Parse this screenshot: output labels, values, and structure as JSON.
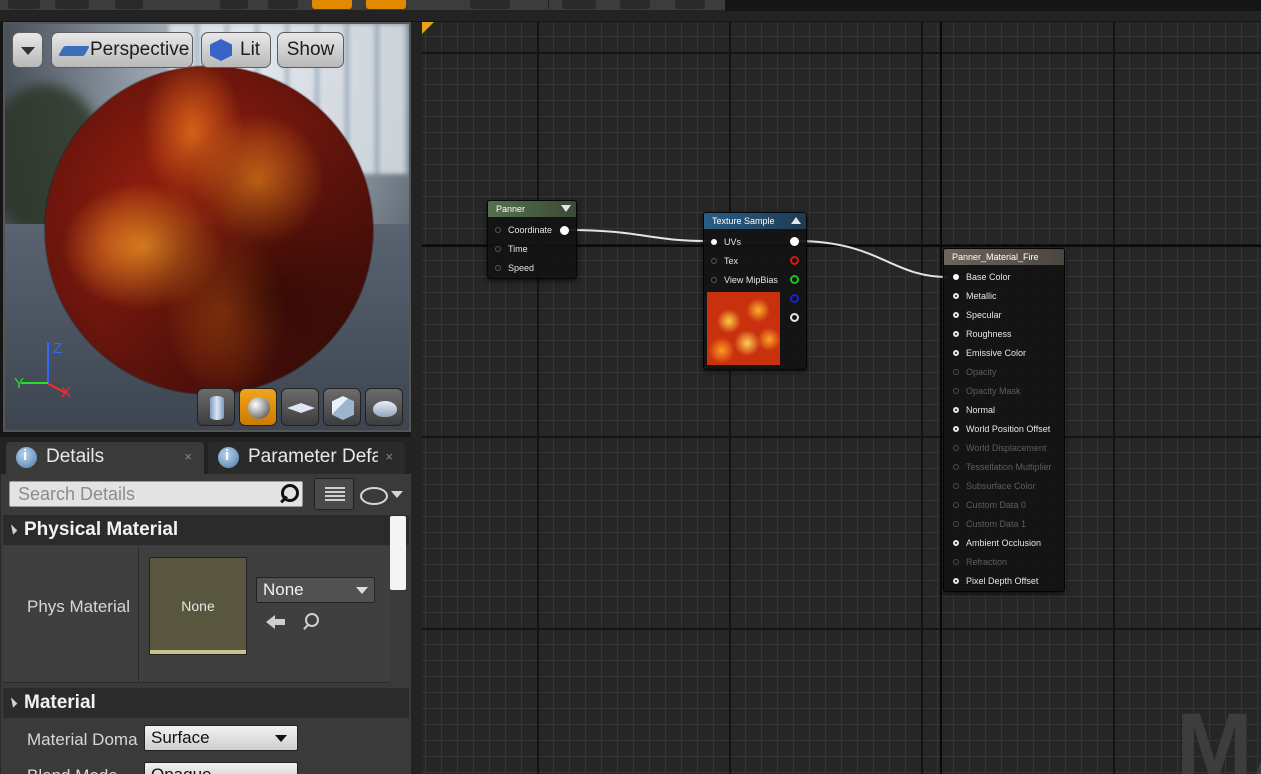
{
  "viewport": {
    "dropdown_label": "",
    "perspective_label": "Perspective",
    "lit_label": "Lit",
    "show_label": "Show",
    "axis": {
      "z": "Z",
      "x": "X",
      "y": "Y"
    },
    "preview_buttons": [
      "cylinder-icon",
      "sphere-icon",
      "plane-icon",
      "cube-icon",
      "teapot-icon"
    ]
  },
  "tabs": [
    {
      "label": "Details",
      "close": "×"
    },
    {
      "label": "Parameter Defa",
      "close": "×"
    }
  ],
  "search": {
    "placeholder": "Search Details"
  },
  "categories": {
    "physical_material": "Physical Material",
    "material": "Material"
  },
  "properties": {
    "phys_material_label": "Phys Material",
    "phys_material_thumb": "None",
    "phys_material_value": "None",
    "material_domain_label": "Material Doma",
    "material_domain_value": "Surface",
    "blend_mode_label": "Blend Mode",
    "blend_mode_value": "Opaque"
  },
  "nodes": {
    "panner": {
      "title": "Panner",
      "inputs": [
        "Coordinate",
        "Time",
        "Speed"
      ]
    },
    "texture_sample": {
      "title": "Texture Sample",
      "inputs": [
        "UVs",
        "Tex",
        "View MipBias"
      ]
    },
    "output": {
      "title": "Panner_Material_Fire",
      "inputs": [
        {
          "label": "Base Color",
          "enabled": true
        },
        {
          "label": "Metallic",
          "enabled": true
        },
        {
          "label": "Specular",
          "enabled": true
        },
        {
          "label": "Roughness",
          "enabled": true
        },
        {
          "label": "Emissive Color",
          "enabled": true
        },
        {
          "label": "Opacity",
          "enabled": false
        },
        {
          "label": "Opacity Mask",
          "enabled": false
        },
        {
          "label": "Normal",
          "enabled": true
        },
        {
          "label": "World Position Offset",
          "enabled": true
        },
        {
          "label": "World Displacement",
          "enabled": false
        },
        {
          "label": "Tessellation Multiplier",
          "enabled": false
        },
        {
          "label": "Subsurface Color",
          "enabled": false
        },
        {
          "label": "Custom Data 0",
          "enabled": false
        },
        {
          "label": "Custom Data 1",
          "enabled": false
        },
        {
          "label": "Ambient Occlusion",
          "enabled": true
        },
        {
          "label": "Refraction",
          "enabled": false
        },
        {
          "label": "Pixel Depth Offset",
          "enabled": true
        }
      ]
    }
  },
  "graph": {
    "watermark": "MA"
  },
  "colors": {
    "accent_orange": "#e08a00",
    "panner_header": "#56704d",
    "texture_header": "#295e86",
    "output_header": "#6b655b"
  }
}
